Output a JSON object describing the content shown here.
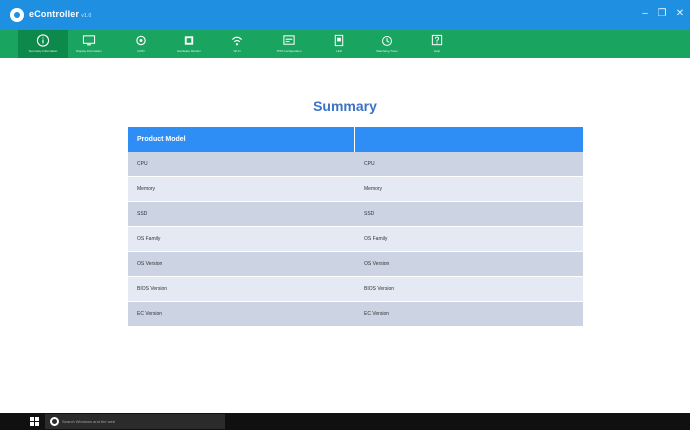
{
  "window": {
    "title": "eController",
    "version": "v1.0",
    "controls": {
      "minimize": "–",
      "maximize": "❐",
      "close": "✕"
    }
  },
  "toolbar": {
    "items": [
      {
        "label": "Summary Information",
        "icon": "info-icon",
        "active": true
      },
      {
        "label": "Display Information",
        "icon": "monitor-icon",
        "active": false
      },
      {
        "label": "GPIO",
        "icon": "gpio-icon",
        "active": false
      },
      {
        "label": "Hardware Monitor",
        "icon": "chip-icon",
        "active": false
      },
      {
        "label": "Wi-Fi",
        "icon": "wifi-icon",
        "active": false
      },
      {
        "label": "TPM Configuration",
        "icon": "tpm-icon",
        "active": false
      },
      {
        "label": "LED",
        "icon": "led-icon",
        "active": false
      },
      {
        "label": "Watchdog Timer",
        "icon": "watchdog-icon",
        "active": false
      },
      {
        "label": "Help",
        "icon": "help-icon",
        "active": false
      }
    ]
  },
  "summary": {
    "title": "Summary",
    "header": [
      "Product Model",
      ""
    ],
    "rows": [
      [
        "CPU",
        "CPU"
      ],
      [
        "Memory",
        "Memory"
      ],
      [
        "SSD",
        "SSD"
      ],
      [
        "OS Family",
        "OS Family"
      ],
      [
        "OS Version",
        "OS Version"
      ],
      [
        "BIOS Version",
        "BIOS Version"
      ],
      [
        "EC Version",
        "EC Version"
      ]
    ]
  },
  "taskbar": {
    "search_placeholder": "Search Windows and the web",
    "start_icon": "windows-logo-icon",
    "cortana_icon": "cortana-icon"
  },
  "colors": {
    "titlebar": "#1e8fe1",
    "toolbar": "#19a45f",
    "toolbar_active": "#0d8a4b",
    "table_header": "#2f8ef5",
    "row_alt": "#ccd3e3",
    "row_plain": "#e4e9f3",
    "summary_title": "#3a73c6",
    "taskbar": "#101010"
  }
}
